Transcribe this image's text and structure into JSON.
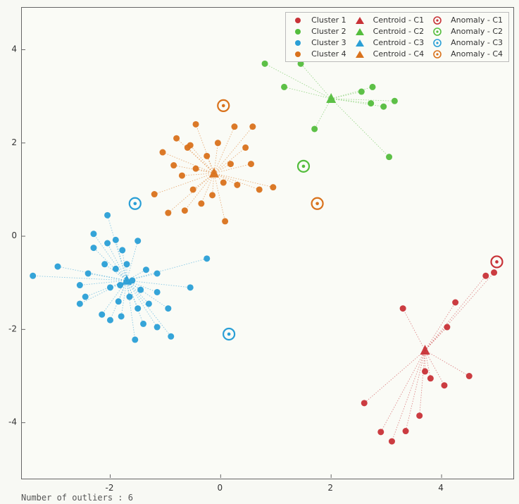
{
  "chart_data": {
    "type": "scatter",
    "title": "",
    "xlabel": "",
    "ylabel": "",
    "xlim": [
      -3.6,
      5.3
    ],
    "ylim": [
      -5.2,
      4.9
    ],
    "xticks": [
      -2,
      0,
      2,
      4
    ],
    "yticks": [
      -4,
      -2,
      0,
      2,
      4
    ],
    "colors": {
      "c1": "#c83237",
      "c2": "#54bd3d",
      "c3": "#2a9fd6",
      "c4": "#d9721c"
    },
    "series": [
      {
        "name": "Cluster 1",
        "color_key": "c1",
        "centroid": {
          "x": 3.7,
          "y": -2.45
        },
        "points": [
          {
            "x": 2.6,
            "y": -3.58
          },
          {
            "x": 2.9,
            "y": -4.2
          },
          {
            "x": 3.1,
            "y": -4.4
          },
          {
            "x": 3.35,
            "y": -4.18
          },
          {
            "x": 3.3,
            "y": -1.55
          },
          {
            "x": 3.6,
            "y": -3.85
          },
          {
            "x": 3.7,
            "y": -2.9
          },
          {
            "x": 3.8,
            "y": -3.05
          },
          {
            "x": 4.1,
            "y": -1.95
          },
          {
            "x": 4.05,
            "y": -3.2
          },
          {
            "x": 4.5,
            "y": -3.0
          },
          {
            "x": 4.25,
            "y": -1.42
          },
          {
            "x": 4.8,
            "y": -0.85
          },
          {
            "x": 4.95,
            "y": -0.78
          }
        ],
        "anomalies": [
          {
            "x": 5.0,
            "y": -0.55
          }
        ]
      },
      {
        "name": "Cluster 2",
        "color_key": "c2",
        "centroid": {
          "x": 2.0,
          "y": 2.95
        },
        "points": [
          {
            "x": 0.8,
            "y": 3.7
          },
          {
            "x": 1.15,
            "y": 3.2
          },
          {
            "x": 1.45,
            "y": 3.7
          },
          {
            "x": 1.7,
            "y": 2.3
          },
          {
            "x": 2.55,
            "y": 3.1
          },
          {
            "x": 2.72,
            "y": 2.85
          },
          {
            "x": 2.75,
            "y": 3.2
          },
          {
            "x": 2.95,
            "y": 2.78
          },
          {
            "x": 3.15,
            "y": 2.9
          },
          {
            "x": 3.05,
            "y": 1.7
          }
        ],
        "anomalies": [
          {
            "x": 1.5,
            "y": 1.5
          }
        ]
      },
      {
        "name": "Cluster 3",
        "color_key": "c3",
        "centroid": {
          "x": -1.7,
          "y": -0.95
        },
        "points": [
          {
            "x": -3.4,
            "y": -0.85
          },
          {
            "x": -2.95,
            "y": -0.65
          },
          {
            "x": -2.55,
            "y": -1.45
          },
          {
            "x": -2.55,
            "y": -1.05
          },
          {
            "x": -2.45,
            "y": -1.3
          },
          {
            "x": -2.4,
            "y": -0.8
          },
          {
            "x": -2.3,
            "y": -0.25
          },
          {
            "x": -2.3,
            "y": 0.05
          },
          {
            "x": -2.15,
            "y": -1.68
          },
          {
            "x": -2.1,
            "y": -0.6
          },
          {
            "x": -2.05,
            "y": 0.45
          },
          {
            "x": -2.05,
            "y": -0.15
          },
          {
            "x": -2.0,
            "y": -1.1
          },
          {
            "x": -2.0,
            "y": -1.8
          },
          {
            "x": -1.9,
            "y": -0.7
          },
          {
            "x": -1.9,
            "y": -0.08
          },
          {
            "x": -1.85,
            "y": -1.4
          },
          {
            "x": -1.82,
            "y": -1.05
          },
          {
            "x": -1.8,
            "y": -1.72
          },
          {
            "x": -1.78,
            "y": -0.3
          },
          {
            "x": -1.7,
            "y": -0.6
          },
          {
            "x": -1.65,
            "y": -1.3
          },
          {
            "x": -1.6,
            "y": -0.95
          },
          {
            "x": -1.55,
            "y": -2.22
          },
          {
            "x": -1.5,
            "y": -1.55
          },
          {
            "x": -1.5,
            "y": -0.1
          },
          {
            "x": -1.45,
            "y": -1.15
          },
          {
            "x": -1.4,
            "y": -1.88
          },
          {
            "x": -1.35,
            "y": -0.72
          },
          {
            "x": -1.3,
            "y": -1.45
          },
          {
            "x": -1.15,
            "y": -1.95
          },
          {
            "x": -1.15,
            "y": -1.2
          },
          {
            "x": -1.15,
            "y": -0.8
          },
          {
            "x": -0.95,
            "y": -1.55
          },
          {
            "x": -0.9,
            "y": -2.15
          },
          {
            "x": -0.55,
            "y": -1.1
          },
          {
            "x": -0.25,
            "y": -0.48
          }
        ],
        "anomalies": [
          {
            "x": -1.55,
            "y": 0.7
          },
          {
            "x": 0.15,
            "y": -2.1
          }
        ]
      },
      {
        "name": "Cluster 4",
        "color_key": "c4",
        "centroid": {
          "x": -0.12,
          "y": 1.35
        },
        "points": [
          {
            "x": -1.2,
            "y": 0.9
          },
          {
            "x": -1.05,
            "y": 1.8
          },
          {
            "x": -0.95,
            "y": 0.5
          },
          {
            "x": -0.85,
            "y": 1.52
          },
          {
            "x": -0.8,
            "y": 2.1
          },
          {
            "x": -0.7,
            "y": 1.3
          },
          {
            "x": -0.65,
            "y": 0.55
          },
          {
            "x": -0.6,
            "y": 1.9
          },
          {
            "x": -0.55,
            "y": 1.95
          },
          {
            "x": -0.5,
            "y": 1.0
          },
          {
            "x": -0.45,
            "y": 2.4
          },
          {
            "x": -0.45,
            "y": 1.45
          },
          {
            "x": -0.35,
            "y": 0.7
          },
          {
            "x": -0.25,
            "y": 1.72
          },
          {
            "x": -0.15,
            "y": 0.88
          },
          {
            "x": -0.05,
            "y": 2.0
          },
          {
            "x": 0.05,
            "y": 1.15
          },
          {
            "x": 0.08,
            "y": 0.32
          },
          {
            "x": 0.18,
            "y": 1.55
          },
          {
            "x": 0.25,
            "y": 2.35
          },
          {
            "x": 0.3,
            "y": 1.1
          },
          {
            "x": 0.45,
            "y": 1.9
          },
          {
            "x": 0.55,
            "y": 1.55
          },
          {
            "x": 0.58,
            "y": 2.35
          },
          {
            "x": 0.7,
            "y": 1.0
          },
          {
            "x": 0.95,
            "y": 1.05
          }
        ],
        "anomalies": [
          {
            "x": 0.05,
            "y": 2.8
          },
          {
            "x": 1.75,
            "y": 0.7
          }
        ]
      }
    ],
    "legend_groups": [
      [
        "Cluster 1",
        "Cluster 2",
        "Cluster 3",
        "Cluster 4"
      ],
      [
        "Centroid - C1",
        "Centroid - C2",
        "Centroid - C3",
        "Centroid - C4"
      ],
      [
        "Anomaly - C1",
        "Anomaly - C2",
        "Anomaly - C3",
        "Anomaly - C4"
      ]
    ]
  },
  "caption": "Number of outliers : 6"
}
